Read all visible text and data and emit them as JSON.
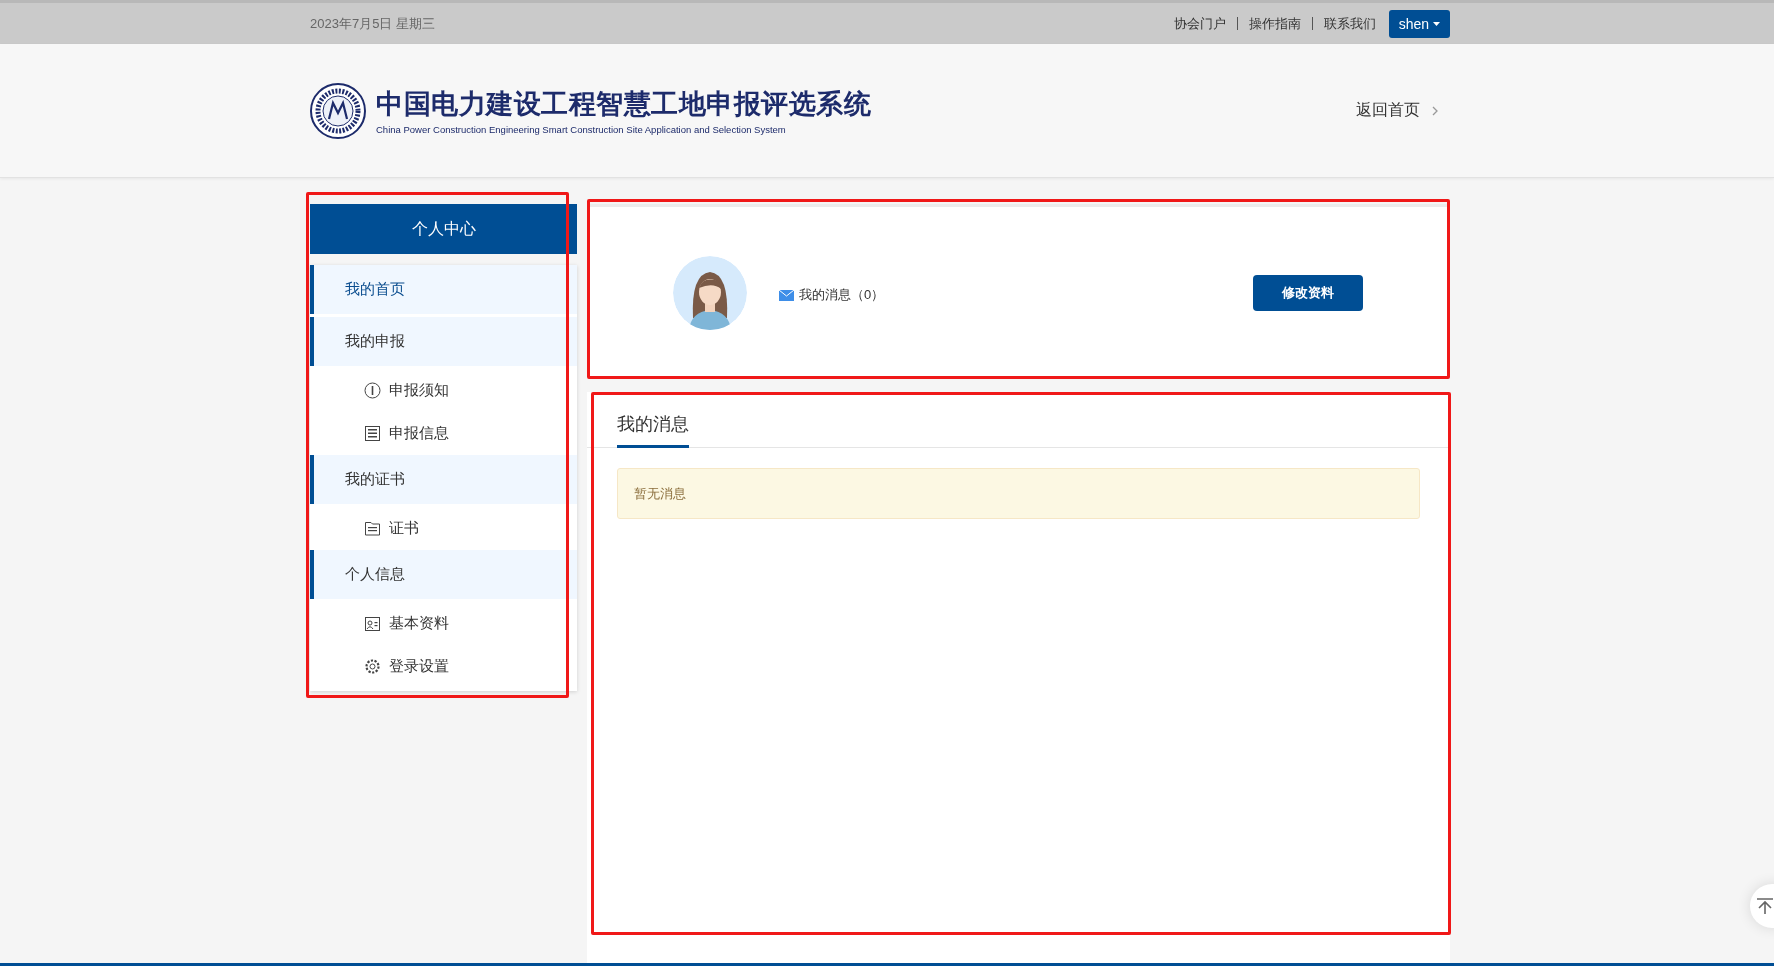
{
  "top_bar": {
    "date": "2023年7月5日 星期三",
    "links": [
      "协会门户",
      "操作指南",
      "联系我们"
    ],
    "user": "shen"
  },
  "header": {
    "title": "中国电力建设工程智慧工地申报评选系统",
    "subtitle": "China Power Construction Engineering Smart Construction Site Application and Selection System",
    "back_link": "返回首页"
  },
  "sidebar": {
    "highlighted": true,
    "title": "个人中心",
    "items": [
      {
        "label": "我的首页",
        "selected": true
      },
      {
        "label": "我的申报",
        "selected": false,
        "children": [
          {
            "label": "申报须知",
            "selected": false
          },
          {
            "label": "申报信息",
            "selected": false
          }
        ]
      },
      {
        "label": "我的证书",
        "selected": false,
        "children": [
          {
            "label": "证书",
            "selected": false
          }
        ]
      },
      {
        "label": "个人信息",
        "selected": false,
        "children": [
          {
            "label": "基本资料",
            "selected": false
          },
          {
            "label": "登录设置",
            "selected": false
          }
        ]
      }
    ]
  },
  "profile": {
    "highlighted": true,
    "messages_link": "我的消息（0）",
    "edit_button": "修改资料"
  },
  "messages": {
    "highlighted": true,
    "tabs": [
      {
        "label": "我的消息",
        "selected": true
      }
    ],
    "empty_notice": "暂无消息"
  }
}
